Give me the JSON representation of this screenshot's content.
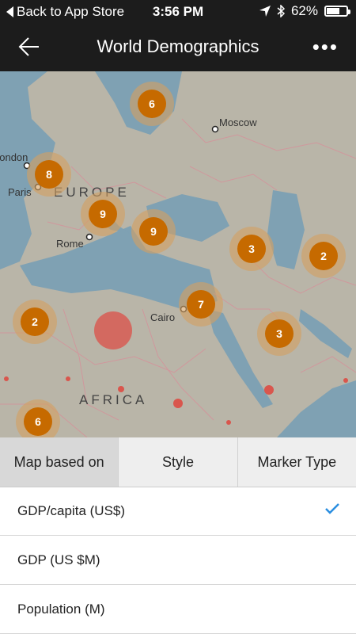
{
  "status_bar": {
    "back_label": "Back to App Store",
    "time": "3:56 PM",
    "battery": "62%"
  },
  "nav": {
    "title": "World Demographics"
  },
  "map": {
    "cities": [
      "Moscow",
      "Paris",
      "Rome",
      "Cairo",
      "London"
    ],
    "regions": {
      "europe": "EUROPE",
      "africa": "AFRICA"
    },
    "clusters": [
      "6",
      "8",
      "9",
      "9",
      "3",
      "2",
      "2",
      "7",
      "3",
      "6"
    ],
    "colors": {
      "cluster": "#c66a00",
      "cluster_ring": "#d4a060",
      "marker": "#d9564d"
    }
  },
  "tabs": [
    {
      "label": "Map based on"
    },
    {
      "label": "Style"
    },
    {
      "label": "Marker Type"
    }
  ],
  "options": [
    {
      "label": "GDP/capita (US$)",
      "selected": true
    },
    {
      "label": "GDP (US $M)"
    },
    {
      "label": "Population (M)"
    }
  ],
  "accent": "#2a8ee0"
}
